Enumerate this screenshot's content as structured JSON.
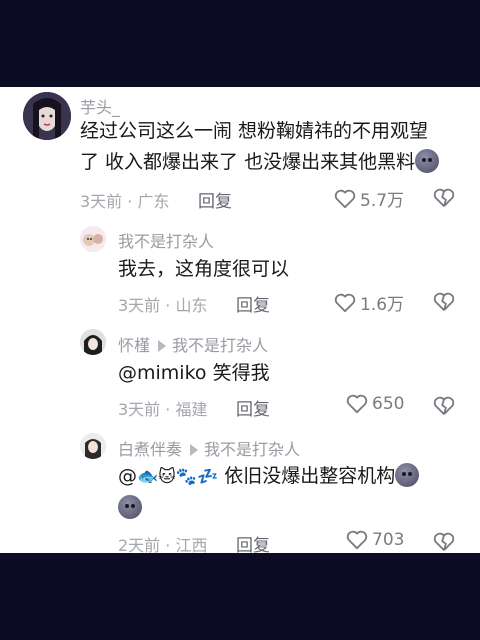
{
  "comments": [
    {
      "username": "芋头_",
      "text_line1": "经过公司这么一闹 想粉鞠婧祎的不用观望",
      "text_line2": "了 收入都爆出来了 也没爆出来其他黑料",
      "time": "3天前 · 广东",
      "reply": "回复",
      "likes": "5.7万"
    },
    {
      "username": "我不是打杂人",
      "text": "我去，这角度很可以",
      "time": "3天前 · 山东",
      "reply": "回复",
      "likes": "1.6万"
    },
    {
      "username": "怀槿",
      "reply_to": "我不是打杂人",
      "mention": "@mimiko",
      "text": "笑得我",
      "time": "3天前 · 福建",
      "reply": "回复",
      "likes": "650"
    },
    {
      "username": "白煮伴奏",
      "reply_to": "我不是打杂人",
      "mention": "@",
      "emojis": "🐟🐱🐾💤",
      "text": "依旧没爆出整容机构",
      "time": "2天前 · 江西",
      "reply": "回复",
      "likes": "703"
    }
  ],
  "icons": [
    "heart-outline-icon",
    "broken-heart-icon",
    "arrow-right-icon",
    "dark-face-emoji"
  ]
}
